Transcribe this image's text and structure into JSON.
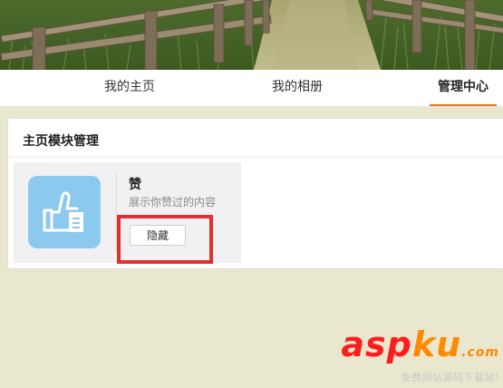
{
  "nav": {
    "tabs": [
      {
        "label": "我的主页"
      },
      {
        "label": "我的相册"
      },
      {
        "label": "管理中心",
        "active": true
      }
    ],
    "accent": "#e8741e"
  },
  "card": {
    "title": "主页模块管理",
    "module": {
      "icon": "thumbs-up-icon",
      "name": "赞",
      "description": "展示你赞过的内容",
      "hide_label": "隐藏",
      "icon_color": "#8cc9ef"
    }
  },
  "annotation": {
    "color": "#e03131"
  },
  "watermark": {
    "logo_part1": "asp",
    "logo_part2": "ku",
    "tld": ".com",
    "slogan": "免费网站源码下载站!"
  }
}
